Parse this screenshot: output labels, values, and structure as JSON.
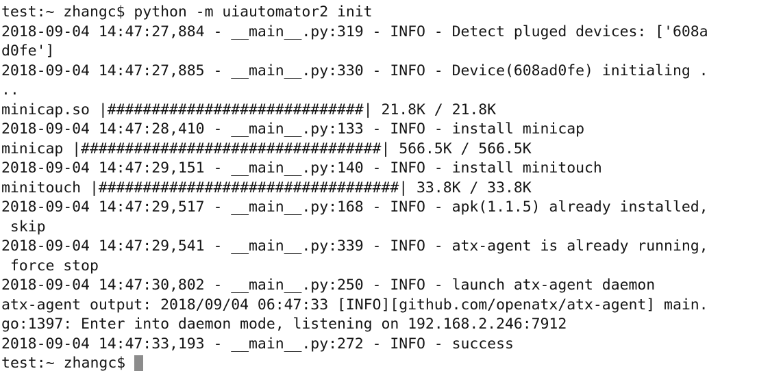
{
  "terminal": {
    "prompt": "test:~ zhangc$",
    "command": "python -m uiautomator2 init",
    "cursor": {
      "name": "block-cursor",
      "color": "#8c8c8c"
    },
    "colors": {
      "background": "#ffffff",
      "foreground": "#151515",
      "cursor": "#8c8c8c"
    },
    "lines": [
      "test:~ zhangc$ python -m uiautomator2 init",
      "2018-09-04 14:47:27,884 - __main__.py:319 - INFO - Detect pluged devices: ['608a",
      "d0fe']",
      "2018-09-04 14:47:27,885 - __main__.py:330 - INFO - Device(608ad0fe) initialing .",
      "..",
      "minicap.so |#############################| 21.8K / 21.8K",
      "2018-09-04 14:47:28,410 - __main__.py:133 - INFO - install minicap",
      "minicap |##################################| 566.5K / 566.5K",
      "2018-09-04 14:47:29,151 - __main__.py:140 - INFO - install minitouch",
      "minitouch |##################################| 33.8K / 33.8K",
      "2018-09-04 14:47:29,517 - __main__.py:168 - INFO - apk(1.1.5) already installed,",
      " skip",
      "2018-09-04 14:47:29,541 - __main__.py:339 - INFO - atx-agent is already running,",
      " force stop",
      "2018-09-04 14:47:30,802 - __main__.py:250 - INFO - launch atx-agent daemon",
      "atx-agent output: 2018/09/04 06:47:33 [INFO][github.com/openatx/atx-agent] main.",
      "go:1397: Enter into daemon mode, listening on 192.168.2.246:7912",
      "2018-09-04 14:47:33,193 - __main__.py:272 - INFO - success"
    ],
    "last_line": "test:~ zhangc$ ",
    "transfers": [
      {
        "name": "minicap.so",
        "done": "21.8K",
        "total": "21.8K",
        "bar_chars": 29
      },
      {
        "name": "minicap",
        "done": "566.5K",
        "total": "566.5K",
        "bar_chars": 34
      },
      {
        "name": "minitouch",
        "done": "33.8K",
        "total": "33.8K",
        "bar_chars": 34
      }
    ],
    "log_entries": [
      {
        "timestamp": "2018-09-04 14:47:27,884",
        "source": "__main__.py:319",
        "level": "INFO",
        "message": "Detect pluged devices: ['608ad0fe']"
      },
      {
        "timestamp": "2018-09-04 14:47:27,885",
        "source": "__main__.py:330",
        "level": "INFO",
        "message": "Device(608ad0fe) initialing ..."
      },
      {
        "timestamp": "2018-09-04 14:47:28,410",
        "source": "__main__.py:133",
        "level": "INFO",
        "message": "install minicap"
      },
      {
        "timestamp": "2018-09-04 14:47:29,151",
        "source": "__main__.py:140",
        "level": "INFO",
        "message": "install minitouch"
      },
      {
        "timestamp": "2018-09-04 14:47:29,517",
        "source": "__main__.py:168",
        "level": "INFO",
        "message": "apk(1.1.5) already installed, skip"
      },
      {
        "timestamp": "2018-09-04 14:47:29,541",
        "source": "__main__.py:339",
        "level": "INFO",
        "message": "atx-agent is already running, force stop"
      },
      {
        "timestamp": "2018-09-04 14:47:30,802",
        "source": "__main__.py:250",
        "level": "INFO",
        "message": "launch atx-agent daemon"
      },
      {
        "timestamp": "2018-09-04 14:47:33,193",
        "source": "__main__.py:272",
        "level": "INFO",
        "message": "success"
      }
    ],
    "agent_output": {
      "prefix": "atx-agent output:",
      "timestamp": "2018/09/04 06:47:33",
      "level": "[INFO]",
      "package": "[github.com/openatx/atx-agent]",
      "location": "main.go:1397",
      "message": "Enter into daemon mode, listening on 192.168.2.246:7912",
      "listen_address": "192.168.2.246:7912"
    }
  }
}
